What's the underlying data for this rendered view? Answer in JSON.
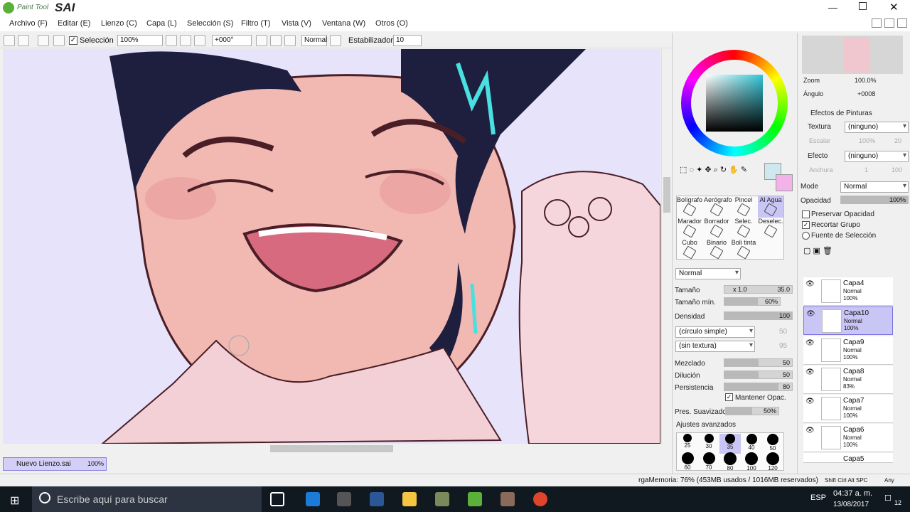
{
  "app": {
    "logo_small": "Paint Tool",
    "logo_big": "SAI"
  },
  "menu": [
    "Archivo (F)",
    "Editar (E)",
    "Lienzo (C)",
    "Capa (L)",
    "Selección (S)",
    "Filtro (T)",
    "Vista (V)",
    "Ventana (W)",
    "Otros (O)"
  ],
  "toolbar": {
    "selection_label": "Selección",
    "zoom": "100%",
    "rotation": "+000°",
    "blend": "Normal",
    "stabilizer_label": "Estabilizador",
    "stabilizer": "10"
  },
  "navigator": {
    "zoom_label": "Zoom",
    "zoom": "100.0%",
    "angle_label": "Ángulo",
    "angle": "+0008"
  },
  "paint_effects": {
    "title": "Efectos de Pinturas",
    "texture_label": "Textura",
    "texture": "(ninguno)",
    "scale_label": "Escalar",
    "scale": "100%",
    "scale2": "20",
    "effect_label": "Efecto",
    "effect": "(ninguno)",
    "width_label": "Anchura",
    "width": "1",
    "width2": "100"
  },
  "layer_props": {
    "mode_label": "Mode",
    "mode": "Normal",
    "opacity_label": "Opacidad",
    "opacity": "100%",
    "preserve": "Preservar Opacidad",
    "clip": "Recortar Grupo",
    "source": "Fuente de Selección"
  },
  "tools": [
    {
      "label": "Selec."
    },
    {
      "label": "Deselec."
    },
    {
      "label": "Bolígrafo"
    },
    {
      "label": "Aerógrafo"
    },
    {
      "label": "Pincel"
    },
    {
      "label": "Al Agua"
    },
    {
      "label": "Marador"
    },
    {
      "label": "Borrador"
    },
    {
      "label": "Cubo"
    },
    {
      "label": "Binario"
    },
    {
      "label": "Boli tinta"
    }
  ],
  "brush": {
    "mode": "Normal",
    "size_label": "Tamaño",
    "size_mult": "x 1.0",
    "size": "35.0",
    "min_label": "Tamaño mín.",
    "min": "60%",
    "density_label": "Densidad",
    "density": "100",
    "shape": "(círculo simple)",
    "shape_val": "50",
    "texture": "(sin textura)",
    "texture_val": "95",
    "blend_label": "Mezclado",
    "blend": "50",
    "dilution_label": "Dilución",
    "dilution": "50",
    "persist_label": "Persistencia",
    "persist": "80",
    "keep_opacity": "Mantener Opac.",
    "smooth_label": "Pres. Suavizado",
    "smooth": "50%",
    "advanced": "Ajustes avanzados"
  },
  "brush_sizes": [
    "25",
    "30",
    "35",
    "40",
    "50",
    "60",
    "70",
    "80",
    "100",
    "120"
  ],
  "layers": [
    {
      "name": "Capa4",
      "mode": "Normal",
      "opacity": "100%"
    },
    {
      "name": "Capa10",
      "mode": "Normal",
      "opacity": "100%"
    },
    {
      "name": "Capa9",
      "mode": "Normal",
      "opacity": "100%"
    },
    {
      "name": "Capa8",
      "mode": "Normal",
      "opacity": "83%"
    },
    {
      "name": "Capa7",
      "mode": "Normal",
      "opacity": "100%"
    },
    {
      "name": "Capa6",
      "mode": "Normal",
      "opacity": "100%"
    },
    {
      "name": "Capa5",
      "mode": "",
      "opacity": ""
    }
  ],
  "doc_tab": {
    "name": "Nuevo Lienzo.sai",
    "zoom": "100%"
  },
  "status": {
    "memory": "rgaMemoria: 76% (453MB usados / 1016MB reservados)",
    "keys": "Shift Ctrl Alt SPC",
    "any": "Any"
  },
  "taskbar": {
    "search": "Escribe aquí para buscar",
    "lang": "ESP",
    "time": "04:37 a. m.",
    "date": "13/08/2017",
    "notif": "12"
  }
}
